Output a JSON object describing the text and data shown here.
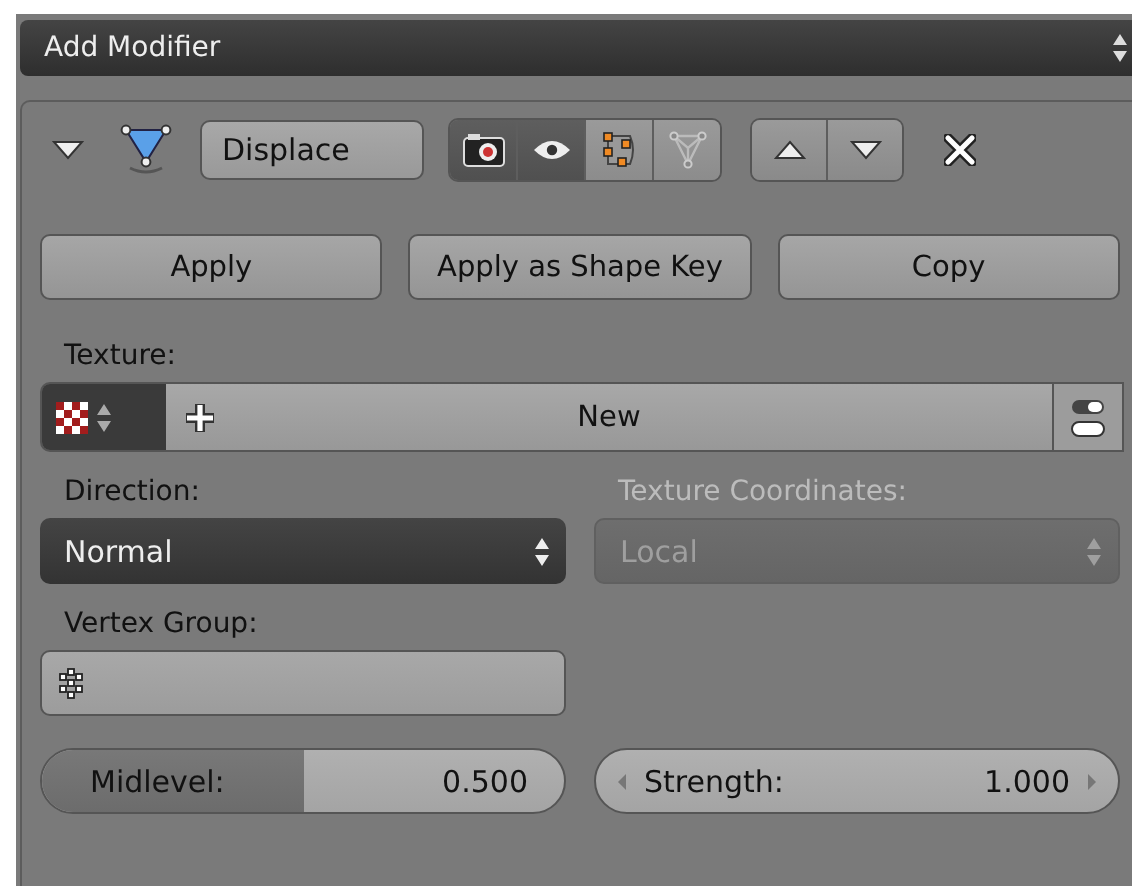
{
  "header": {
    "title": "Add Modifier"
  },
  "modifier": {
    "expanded": true,
    "name": "Displace",
    "toggles": [
      {
        "kind": "render",
        "on": true
      },
      {
        "kind": "realtime",
        "on": true
      },
      {
        "kind": "editmode",
        "on": false
      },
      {
        "kind": "cage",
        "on": false
      }
    ]
  },
  "actions": [
    "Apply",
    "Apply as Shape Key",
    "Copy"
  ],
  "texture": {
    "label": "Texture:",
    "value": "New"
  },
  "direction": {
    "label": "Direction:",
    "value": "Normal",
    "disabled": false
  },
  "texture_coordinates": {
    "label": "Texture Coordinates:",
    "value": "Local",
    "disabled": true
  },
  "vertex_group": {
    "label": "Vertex Group:"
  },
  "fields": [
    {
      "kind": "slider",
      "label": "Midlevel:",
      "value": "0.500",
      "level": 0.5
    },
    {
      "kind": "number",
      "label": "Strength:",
      "value": "1.000"
    }
  ]
}
